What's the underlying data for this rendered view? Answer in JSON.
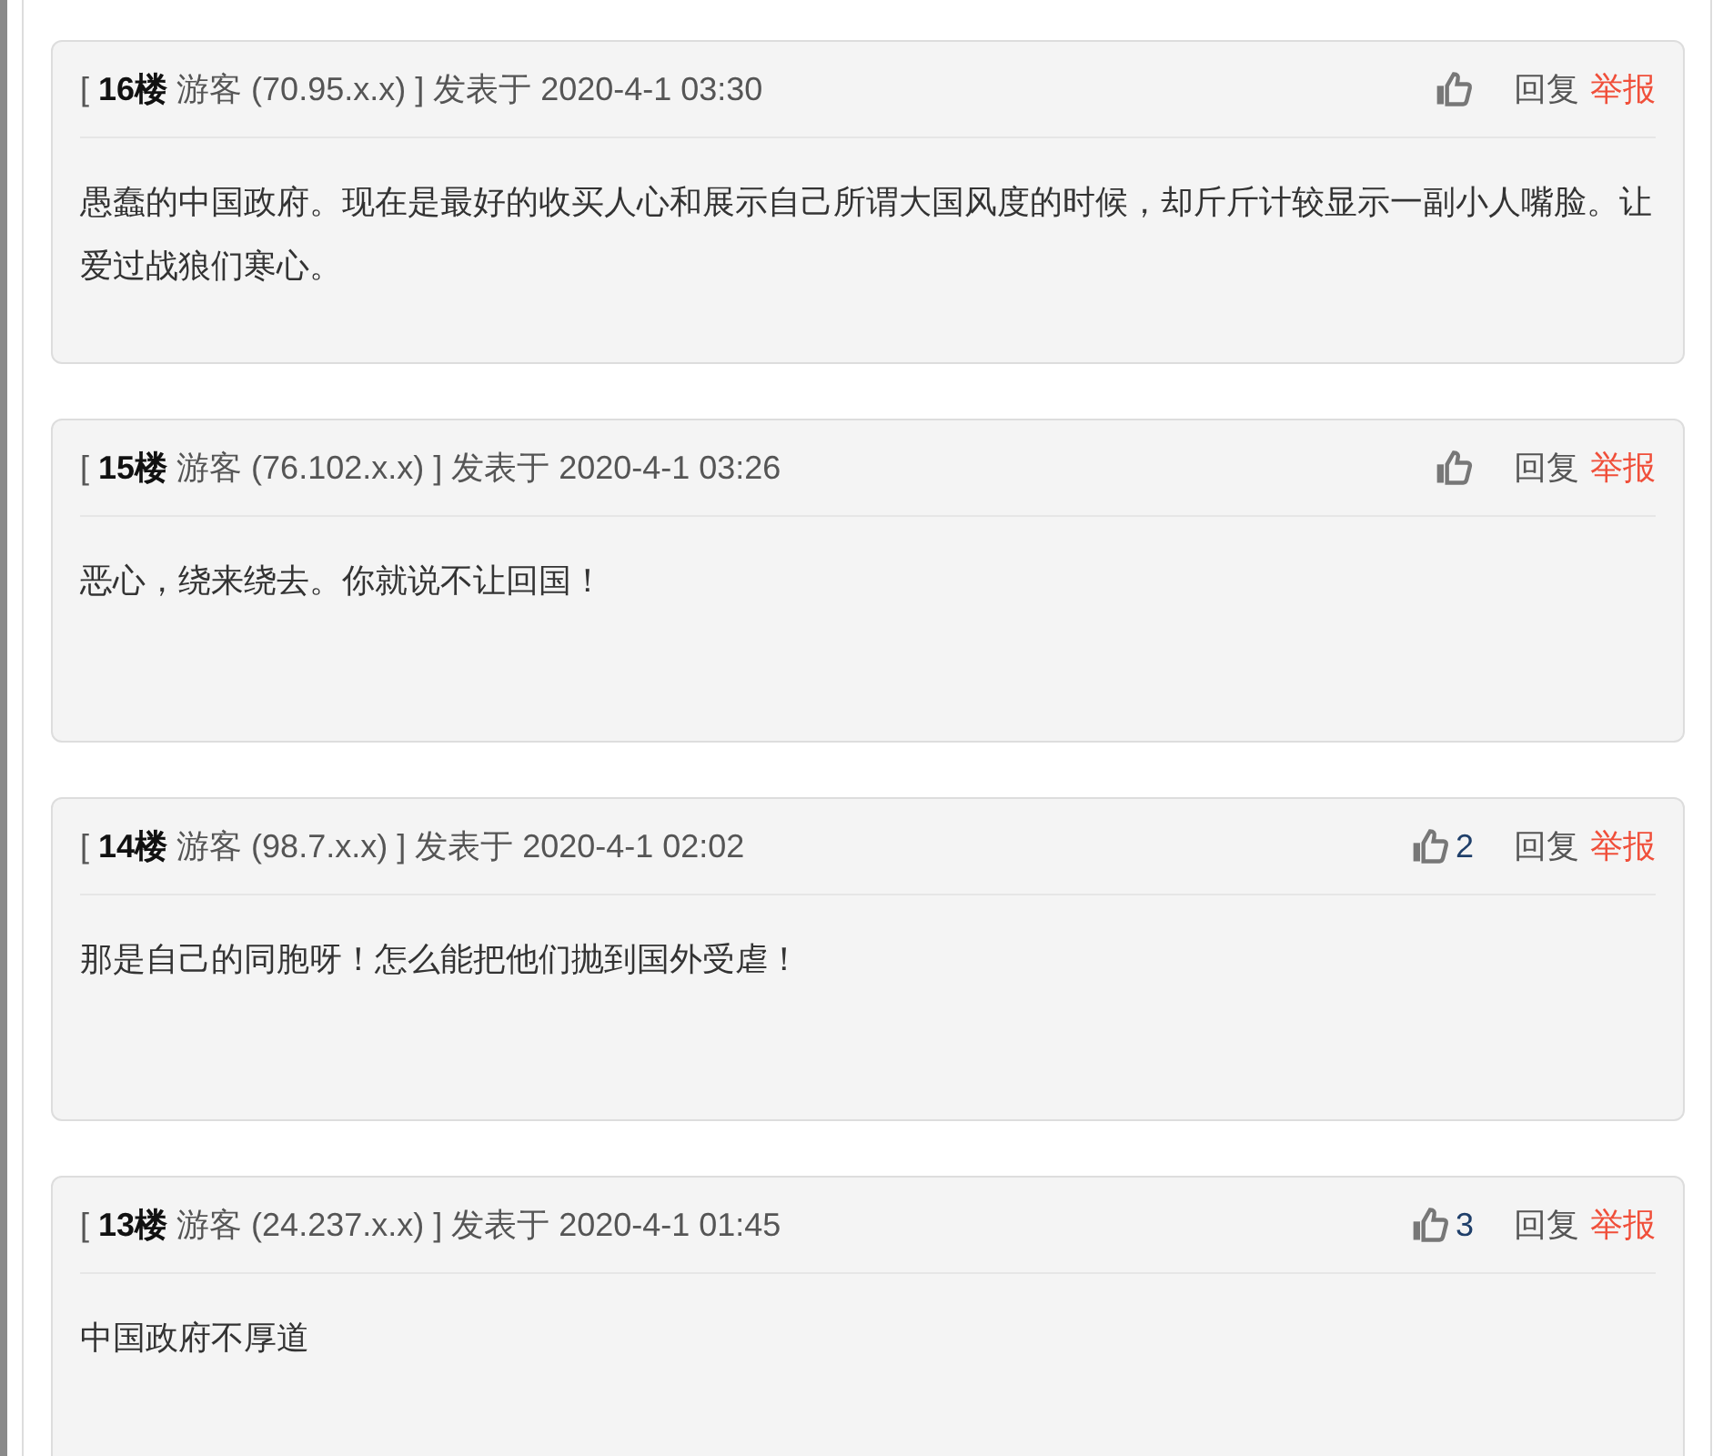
{
  "posts": [
    {
      "header": "[ **16楼** 游客 (70.95.x.x) ] 发表于 2020-4-1 03:30",
      "reply": "回复",
      "report": "举报",
      "body": "愚蠢的中国政府。现在是最好的收买人心和展示自己所谓大国风度的时候，却斤斤计较显示一副小人嘴脸。让爱过战狼们寒心。"
    },
    {
      "header": "[ **15楼** 游客 (76.102.x.x) ] 发表于 2020-4-1 03:26",
      "reply": "回复",
      "report": "举报",
      "body": "恶心，绕来绕去。你就说不让回国！"
    },
    {
      "header": "[ **14楼** 游客 (98.7.x.x) ] 发表于 2020-4-1 02:02",
      "likes": "2",
      "reply": "回复",
      "report": "举报",
      "body": "那是自己的同胞呀！怎么能把他们抛到国外受虐！"
    },
    {
      "header": "[ **13楼** 游客 (24.237.x.x) ] 发表于 2020-4-1 01:45",
      "likes": "3",
      "reply": "回复",
      "report": "举报",
      "body": "中国政府不厚道"
    }
  ]
}
